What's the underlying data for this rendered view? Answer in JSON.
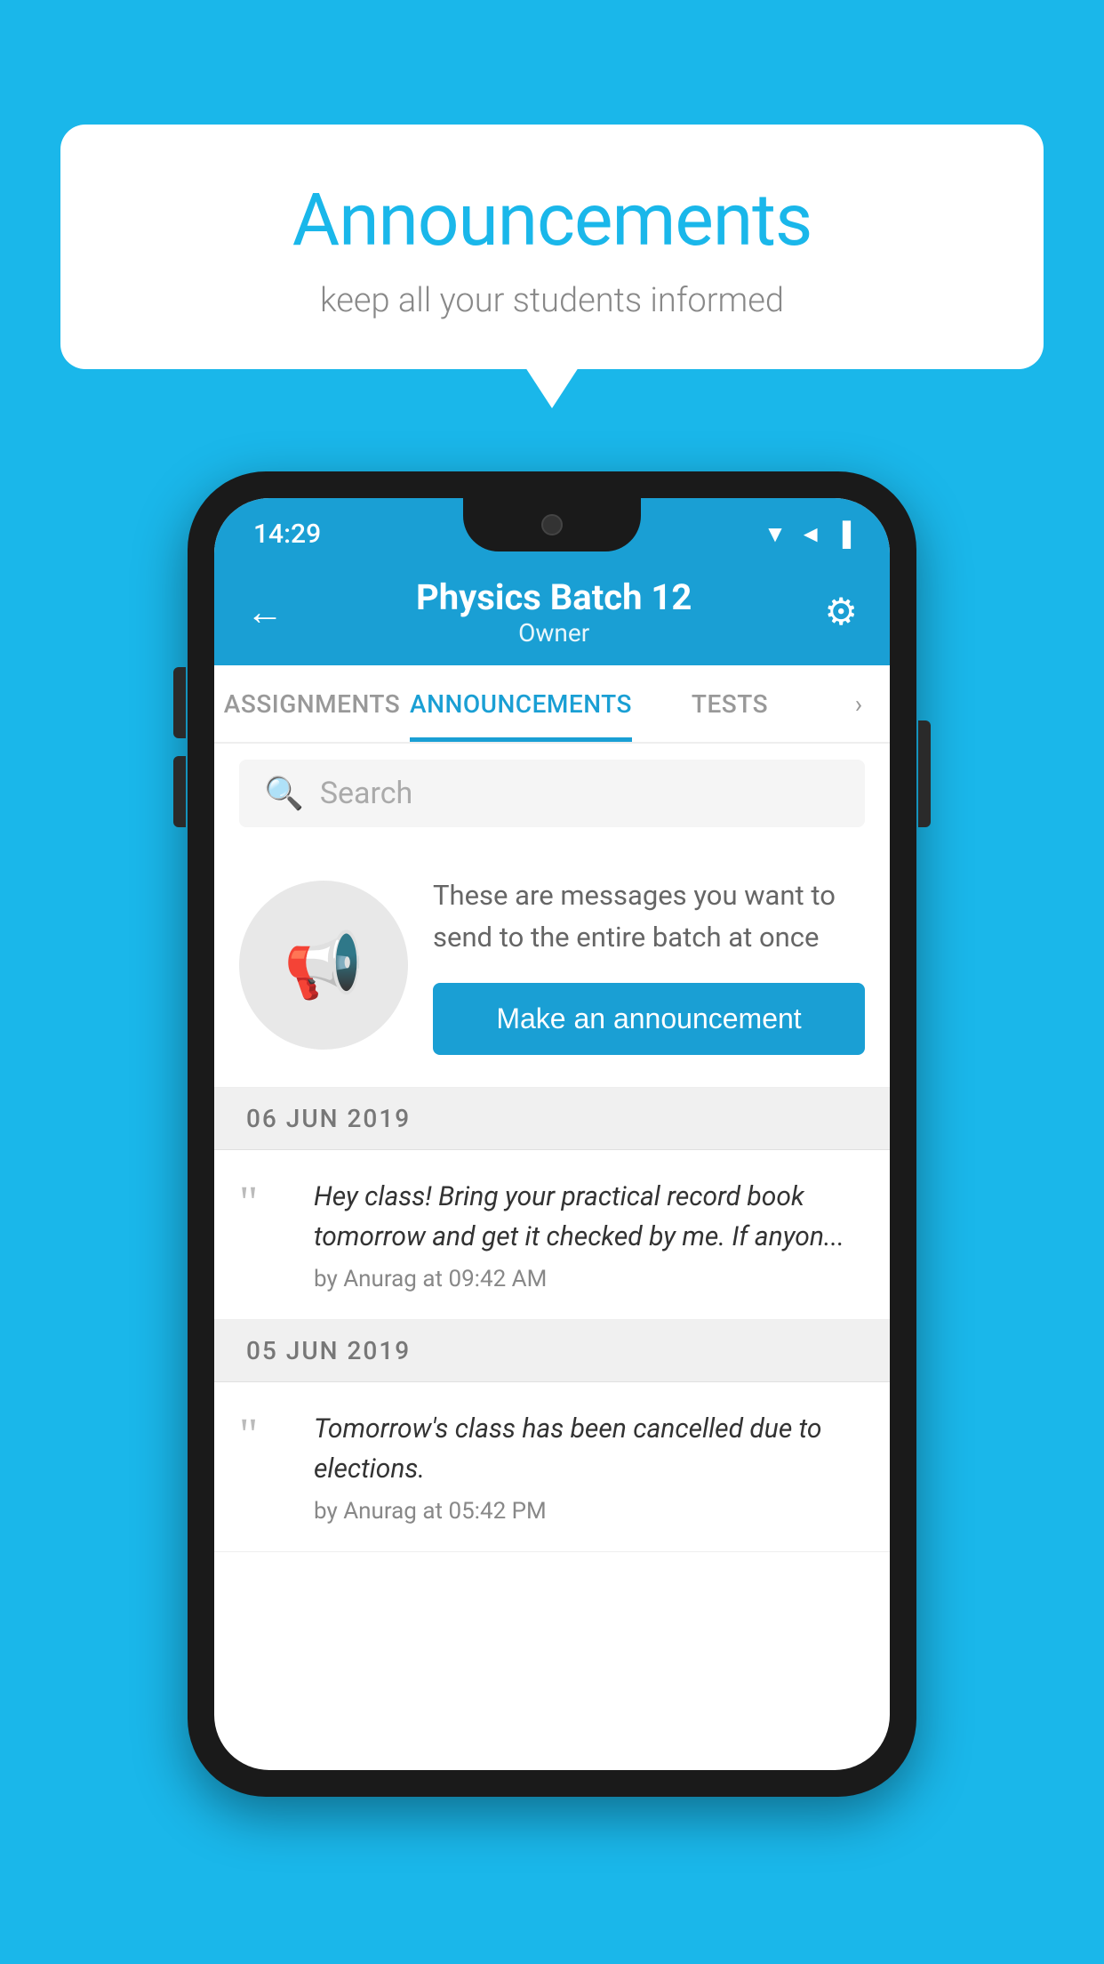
{
  "background_color": "#1ab7ea",
  "speech_bubble": {
    "title": "Announcements",
    "subtitle": "keep all your students informed"
  },
  "phone": {
    "status_bar": {
      "time": "14:29",
      "wifi": "▲",
      "signal": "▲",
      "battery": "▐"
    },
    "app_bar": {
      "back_label": "←",
      "title": "Physics Batch 12",
      "subtitle": "Owner",
      "settings_label": "⚙"
    },
    "tabs": [
      {
        "label": "ASSIGNMENTS",
        "active": false
      },
      {
        "label": "ANNOUNCEMENTS",
        "active": true
      },
      {
        "label": "TESTS",
        "active": false
      }
    ],
    "tabs_more": "›",
    "search": {
      "placeholder": "Search"
    },
    "promo": {
      "description": "These are messages you want to send to the entire batch at once",
      "button_label": "Make an announcement"
    },
    "announcements": [
      {
        "date": "06  JUN  2019",
        "text": "Hey class! Bring your practical record book tomorrow and get it checked by me. If anyon...",
        "meta": "by Anurag at 09:42 AM"
      },
      {
        "date": "05  JUN  2019",
        "text": "Tomorrow's class has been cancelled due to elections.",
        "meta": "by Anurag at 05:42 PM"
      }
    ]
  }
}
